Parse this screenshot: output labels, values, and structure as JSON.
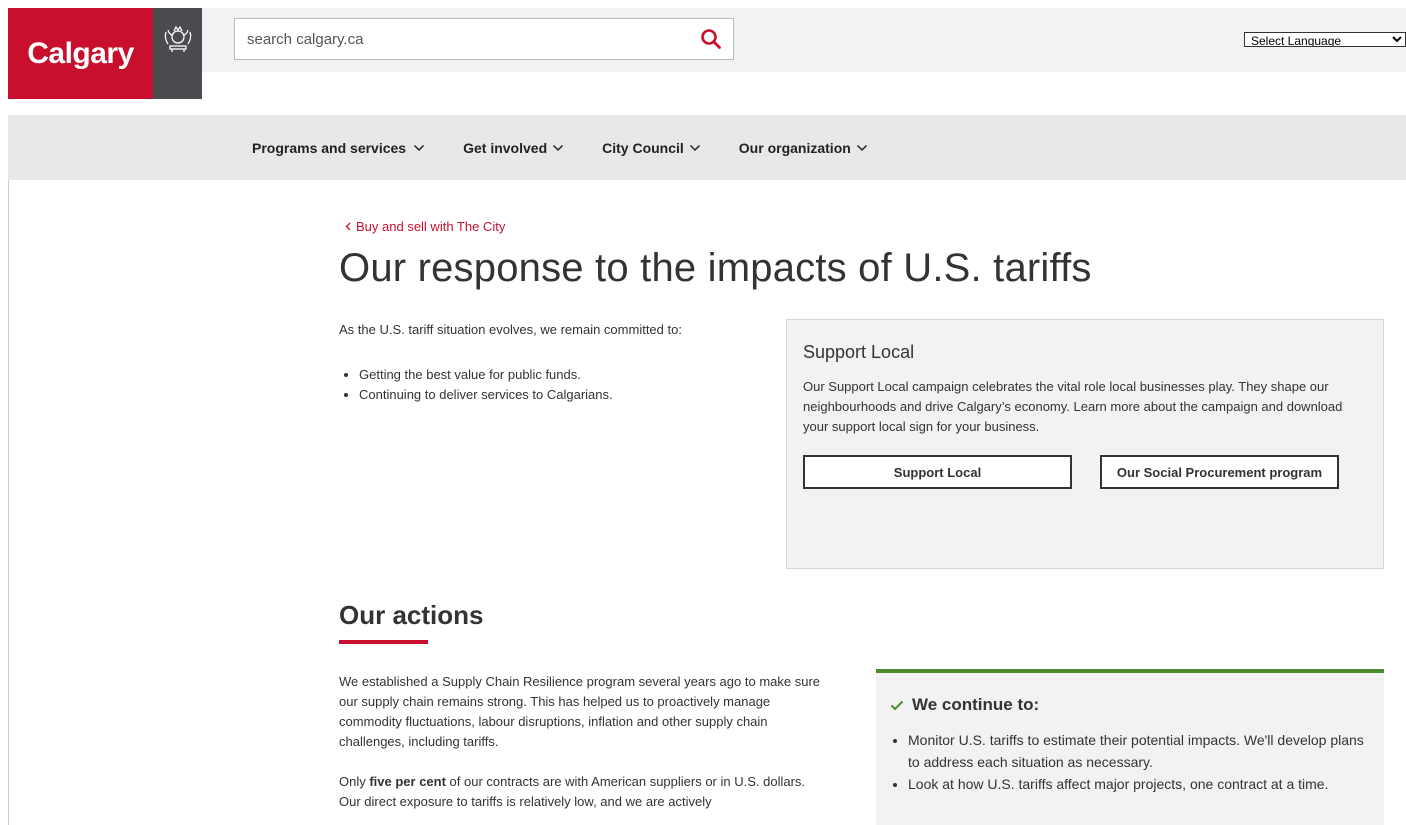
{
  "header": {
    "logo_text": "Calgary",
    "search_placeholder": "search calgary.ca",
    "language": {
      "selected": "Select Language"
    }
  },
  "nav": {
    "items": [
      {
        "label": "Programs and services"
      },
      {
        "label": "Get involved"
      },
      {
        "label": "City Council"
      },
      {
        "label": "Our organization"
      }
    ]
  },
  "breadcrumb": {
    "label": "Buy and sell with The City"
  },
  "page": {
    "title": "Our response to the impacts of U.S. tariffs"
  },
  "intro": {
    "text": "As the U.S. tariff situation evolves, we remain committed to:",
    "bullets": [
      "Getting the best value for public funds.",
      "Continuing to deliver services to Calgarians."
    ]
  },
  "support_local": {
    "title": "Support Local",
    "body": "Our Support Local campaign celebrates the vital role local businesses play. They shape our neighbourhoods and drive Calgary’s economy. Learn more about the campaign and download your support local sign for your business.",
    "button_1": "Support Local",
    "button_2": "Our Social Procurement program"
  },
  "actions": {
    "title": "Our actions",
    "para_1": "We established a Supply Chain Resilience program several years ago to make sure our supply chain remains strong. This has helped us to proactively manage commodity fluctuations, labour disruptions, inflation and other supply chain challenges, including tariffs.",
    "para_2_start": "Only ",
    "para_2_bold": "five per cent",
    "para_2_end": " of our contracts are with American suppliers or in U.S. dollars. Our direct exposure to tariffs is relatively low, and we are actively"
  },
  "continue": {
    "title": "We continue to:",
    "bullets": [
      "Monitor U.S. tariffs to estimate their potential impacts. We'll develop plans to address each situation as necessary.",
      "Look at how U.S. tariffs affect major projects, one contract at a time."
    ]
  },
  "colors": {
    "brand_red": "#c8102e",
    "logo_grey": "#4a4a4f",
    "accent_green": "#4d8b31"
  }
}
